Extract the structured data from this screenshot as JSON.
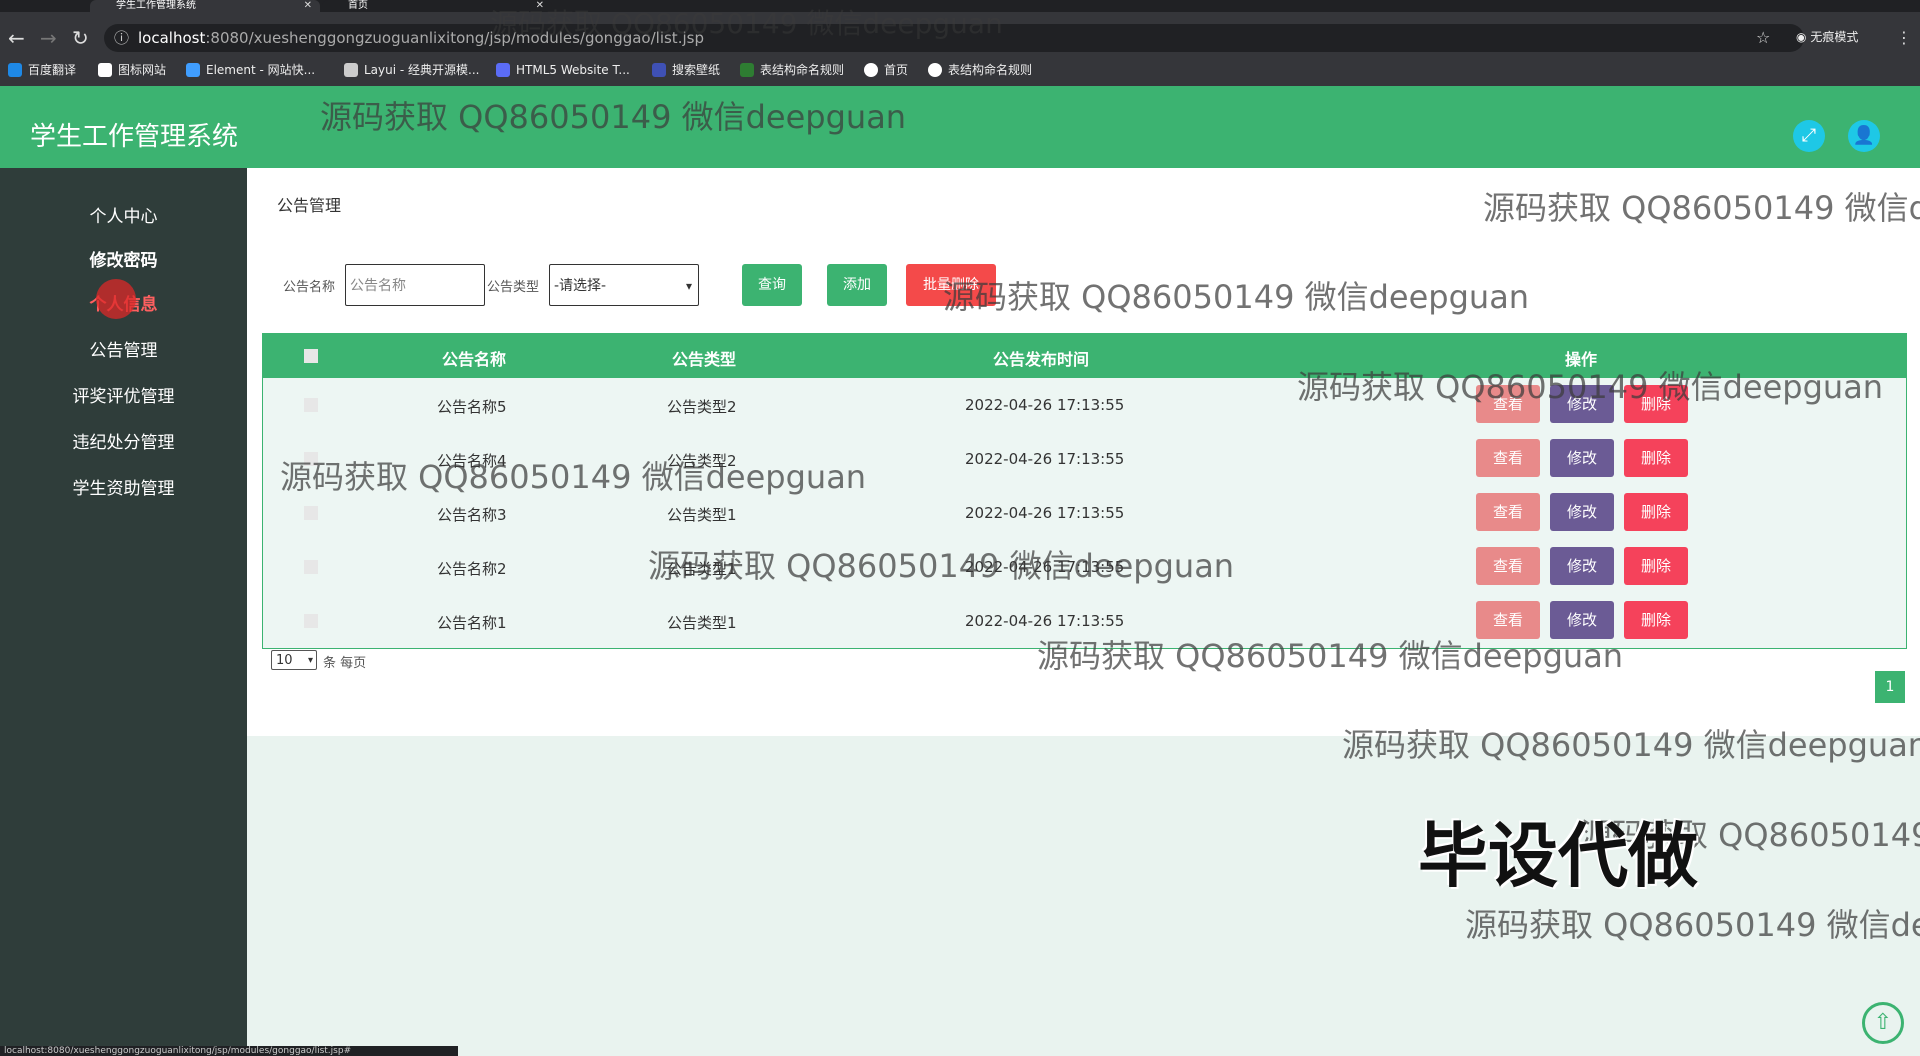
{
  "browser": {
    "tabs": [
      {
        "label": "学生工作管理系统"
      },
      {
        "label": "首页"
      }
    ],
    "url_host": "localhost",
    "url_path": ":8080/xueshenggongzuoguanlixitong/jsp/modules/gonggao/list.jsp",
    "incognito_label": "无痕模式",
    "bookmarks": [
      {
        "label": "百度翻译",
        "color": "#1e88e5"
      },
      {
        "label": "图标网站",
        "color": "#ffffff"
      },
      {
        "label": "Element - 网站快...",
        "color": "#409eff"
      },
      {
        "label": "Layui - 经典开源模...",
        "color": "#cccccc"
      },
      {
        "label": "HTML5 Website T...",
        "color": "#5b6cf5"
      },
      {
        "label": "搜索壁纸",
        "color": "#3f51b5"
      },
      {
        "label": "表结构命名规则",
        "color": "#2e7d32"
      },
      {
        "label": "首页",
        "color": "#ffffff"
      },
      {
        "label": "表结构命名规则",
        "color": "#ffffff"
      }
    ],
    "status_url": "localhost:8080/xueshenggongzuoguanlixitong/jsp/modules/gonggao/list.jsp#"
  },
  "header": {
    "title": "学生工作管理系统"
  },
  "sidebar": {
    "items": [
      {
        "label": "个人中心"
      },
      {
        "label": "修改密码"
      },
      {
        "label": "个人信息"
      },
      {
        "label": "公告管理"
      },
      {
        "label": "评奖评优管理"
      },
      {
        "label": "违纪处分管理"
      },
      {
        "label": "学生资助管理"
      }
    ]
  },
  "page": {
    "breadcrumb": "公告管理",
    "search": {
      "name_label": "公告名称",
      "name_placeholder": "公告名称",
      "type_label": "公告类型",
      "type_selected": "-请选择-",
      "query_btn": "查询",
      "add_btn": "添加",
      "batch_delete_btn": "批量删除"
    },
    "table": {
      "headers": [
        "公告名称",
        "公告类型",
        "公告发布时间",
        "操作"
      ],
      "rows": [
        {
          "name": "公告名称5",
          "type": "公告类型2",
          "time": "2022-04-26 17:13:55"
        },
        {
          "name": "公告名称4",
          "type": "公告类型2",
          "time": "2022-04-26 17:13:55"
        },
        {
          "name": "公告名称3",
          "type": "公告类型1",
          "time": "2022-04-26 17:13:55"
        },
        {
          "name": "公告名称2",
          "type": "公告类型1",
          "time": "2022-04-26 17:13:55"
        },
        {
          "name": "公告名称1",
          "type": "公告类型1",
          "time": "2022-04-26 17:13:55"
        }
      ],
      "actions": {
        "view": "查看",
        "edit": "修改",
        "delete": "删除"
      }
    },
    "pager": {
      "page_size": "10",
      "per_page_label": "条 每页",
      "current_page": "1"
    }
  },
  "watermark": {
    "text": "源码获取 QQ86050149 微信deepguan",
    "big_text": "毕设代做"
  },
  "colors": {
    "primary_green": "#3cb371",
    "view_btn": "#e88a8a",
    "edit_btn": "#6b5b95",
    "delete_btn": "#f5425b",
    "batch_delete_btn": "#f44a4a"
  }
}
